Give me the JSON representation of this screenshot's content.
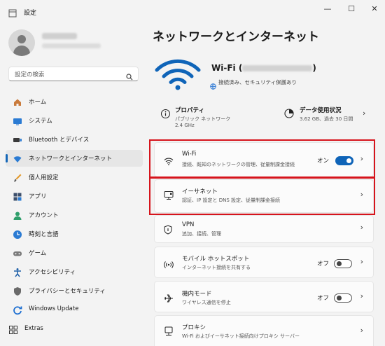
{
  "window": {
    "title": "設定",
    "minimize_glyph": "—",
    "maximize_glyph": "☐",
    "close_glyph": "✕"
  },
  "sidebar": {
    "search_placeholder": "設定の検索",
    "items": [
      {
        "label": "ホーム",
        "icon": "home-icon"
      },
      {
        "label": "システム",
        "icon": "system-icon"
      },
      {
        "label": "Bluetooth とデバイス",
        "icon": "bluetooth-icon"
      },
      {
        "label": "ネットワークとインターネット",
        "icon": "network-icon"
      },
      {
        "label": "個人用設定",
        "icon": "brush-icon"
      },
      {
        "label": "アプリ",
        "icon": "apps-icon"
      },
      {
        "label": "アカウント",
        "icon": "account-icon"
      },
      {
        "label": "時刻と言語",
        "icon": "time-language-icon"
      },
      {
        "label": "ゲーム",
        "icon": "gamepad-icon"
      },
      {
        "label": "アクセシビリティ",
        "icon": "accessibility-icon"
      },
      {
        "label": "プライバシーとセキュリティ",
        "icon": "shield-icon"
      },
      {
        "label": "Windows Update",
        "icon": "windows-update-icon"
      },
      {
        "label": "Extras",
        "icon": "extras-icon"
      }
    ],
    "active_index": 3
  },
  "main": {
    "title": "ネットワークとインターネット",
    "connection": {
      "name_prefix": "Wi-Fi (",
      "name_suffix": ")",
      "status": "接続済み、セキュリティ保護あり"
    },
    "properties": {
      "title": "プロパティ",
      "sub1": "パブリック ネットワーク",
      "sub2": "2.4 GHz"
    },
    "data_usage": {
      "title": "データ使用状況",
      "sub": "3.62 GB、過去 30 日間"
    },
    "cards": [
      {
        "title": "Wi-Fi",
        "sub": "接続、既知のネットワークの管理、従量制課金接続",
        "toggle": "オン",
        "icon": "wifi-icon"
      },
      {
        "title": "イーサネット",
        "sub": "認証、IP 設定と DNS 設定、従量制課金接続",
        "icon": "ethernet-icon"
      },
      {
        "title": "VPN",
        "sub": "追加、接続、管理",
        "icon": "vpn-shield-icon"
      },
      {
        "title": "モバイル ホットスポット",
        "sub": "インターネット接続を共有する",
        "toggle": "オフ",
        "icon": "hotspot-icon"
      },
      {
        "title": "機内モード",
        "sub": "ワイヤレス通信を停止",
        "toggle": "オフ",
        "icon": "airplane-icon"
      },
      {
        "title": "プロキシ",
        "sub": "Wi-Fi およびイーサネット接続向けプロキシ サーバー",
        "icon": "proxy-icon"
      }
    ]
  },
  "colors": {
    "accent": "#0f64b8",
    "highlight": "#d6141c",
    "background": "#f3f3f3"
  }
}
